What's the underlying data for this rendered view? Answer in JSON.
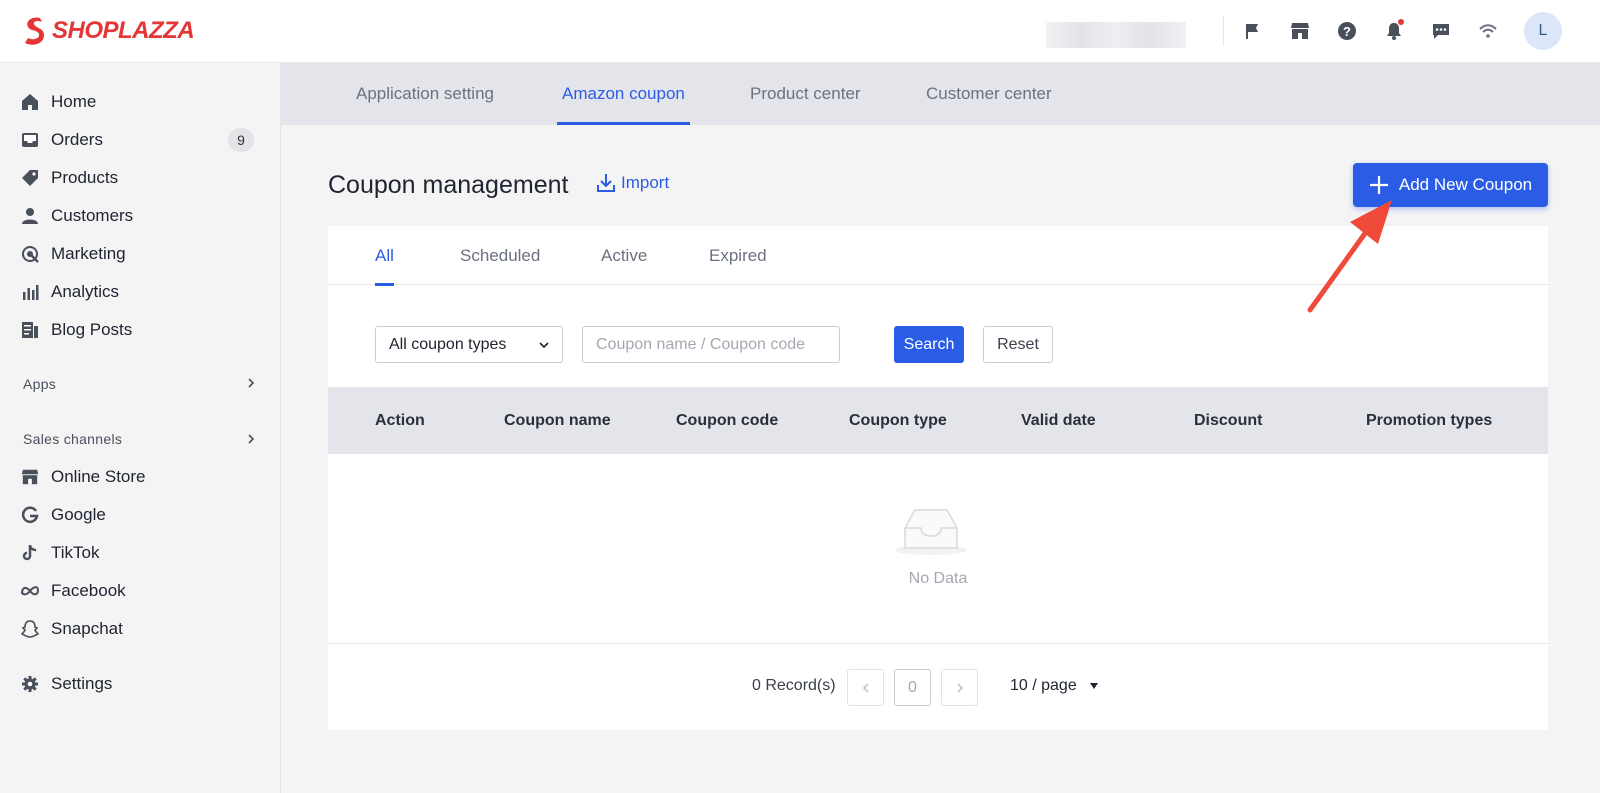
{
  "brand": {
    "name": "SHOPLAZZA",
    "color": "#e53535"
  },
  "accent": "#2b5ce6",
  "header": {
    "icons": [
      "flag-icon",
      "store-icon",
      "help-icon",
      "bell-icon",
      "chat-icon",
      "wifi-icon"
    ],
    "avatar_initial": "L"
  },
  "sidebar": {
    "items": [
      {
        "label": "Home",
        "icon": "home-icon"
      },
      {
        "label": "Orders",
        "icon": "inbox-icon",
        "badge": "9"
      },
      {
        "label": "Products",
        "icon": "tag-icon"
      },
      {
        "label": "Customers",
        "icon": "user-icon"
      },
      {
        "label": "Marketing",
        "icon": "target-icon"
      },
      {
        "label": "Analytics",
        "icon": "bar-chart-icon"
      },
      {
        "label": "Blog Posts",
        "icon": "blog-icon"
      }
    ],
    "apps_label": "Apps",
    "sales_channels_label": "Sales channels",
    "channels": [
      {
        "label": "Online Store",
        "icon": "store-icon"
      },
      {
        "label": "Google",
        "icon": "google-icon"
      },
      {
        "label": "TikTok",
        "icon": "tiktok-icon"
      },
      {
        "label": "Facebook",
        "icon": "meta-icon"
      },
      {
        "label": "Snapchat",
        "icon": "snapchat-icon"
      }
    ],
    "settings_label": "Settings"
  },
  "top_tabs": [
    {
      "label": "Application setting",
      "active": false
    },
    {
      "label": "Amazon coupon",
      "active": true
    },
    {
      "label": "Product center",
      "active": false
    },
    {
      "label": "Customer center",
      "active": false
    }
  ],
  "page": {
    "title": "Coupon management",
    "import_label": "Import",
    "add_button_label": "Add New Coupon"
  },
  "sub_tabs": [
    {
      "label": "All",
      "active": true
    },
    {
      "label": "Scheduled",
      "active": false
    },
    {
      "label": "Active",
      "active": false
    },
    {
      "label": "Expired",
      "active": false
    }
  ],
  "filters": {
    "type_select_value": "All coupon types",
    "search_placeholder": "Coupon name / Coupon code",
    "search_label": "Search",
    "reset_label": "Reset"
  },
  "table": {
    "columns": [
      "Action",
      "Coupon name",
      "Coupon code",
      "Coupon type",
      "Valid date",
      "Discount",
      "Promotion types"
    ],
    "rows": [],
    "empty_text": "No Data"
  },
  "pagination": {
    "records_text": "0 Record(s)",
    "current_page": "0",
    "per_page": "10 / page"
  }
}
